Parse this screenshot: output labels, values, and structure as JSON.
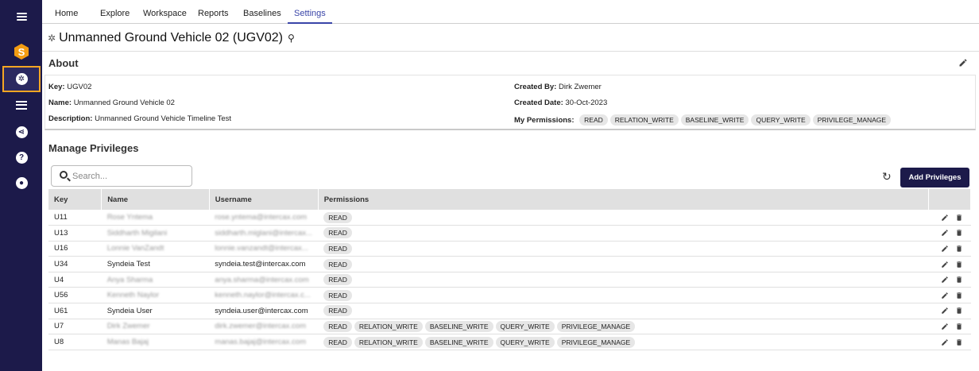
{
  "nav": {
    "tabs": [
      {
        "label": "Home"
      },
      {
        "label": "Explore"
      },
      {
        "label": "Workspace"
      },
      {
        "label": "Reports"
      },
      {
        "label": "Baselines"
      },
      {
        "label": "Settings"
      }
    ],
    "active_tab": "Settings"
  },
  "rail": {
    "icons": [
      "menu-icon",
      "syndeia-logo-icon",
      "project-icon",
      "list-icon",
      "share-icon",
      "help-icon",
      "account-icon"
    ]
  },
  "page": {
    "title": "Unmanned Ground Vehicle 02 (UGV02)"
  },
  "about": {
    "heading": "About",
    "key_label": "Key:",
    "key_value": "UGV02",
    "name_label": "Name:",
    "name_value": "Unmanned Ground Vehicle 02",
    "desc_label": "Description:",
    "desc_value": "Unmanned Ground Vehicle Timeline Test",
    "created_by_label": "Created By:",
    "created_by_value": "Dirk Zwemer",
    "created_date_label": "Created Date:",
    "created_date_value": "30-Oct-2023",
    "perms_label": "My Permissions:",
    "perms": [
      "READ",
      "RELATION_WRITE",
      "BASELINE_WRITE",
      "QUERY_WRITE",
      "PRIVILEGE_MANAGE"
    ]
  },
  "privileges": {
    "heading": "Manage Privileges",
    "search_placeholder": "Search...",
    "add_label": "Add Privileges",
    "columns": [
      "Key",
      "Name",
      "Username",
      "Permissions"
    ],
    "rows": [
      {
        "key": "U11",
        "name": "Rose Yntema",
        "username": "rose.yntema@intercax.com",
        "perms": [
          "READ"
        ],
        "blurred": true
      },
      {
        "key": "U13",
        "name": "Siddharth Migilani",
        "username": "siddharth.miglani@intercax...",
        "perms": [
          "READ"
        ],
        "blurred": true
      },
      {
        "key": "U16",
        "name": "Lonnie VanZandt",
        "username": "lonnie.vanzandt@intercax...",
        "perms": [
          "READ"
        ],
        "blurred": true
      },
      {
        "key": "U34",
        "name": "Syndeia Test",
        "username": "syndeia.test@intercax.com",
        "perms": [
          "READ"
        ],
        "blurred": false
      },
      {
        "key": "U4",
        "name": "Anya Sharma",
        "username": "anya.sharma@intercax.com",
        "perms": [
          "READ"
        ],
        "blurred": true
      },
      {
        "key": "U56",
        "name": "Kenneth Naylor",
        "username": "kenneth.naylor@intercax.c...",
        "perms": [
          "READ"
        ],
        "blurred": true
      },
      {
        "key": "U61",
        "name": "Syndeia User",
        "username": "syndeia.user@intercax.com",
        "perms": [
          "READ"
        ],
        "blurred": false
      },
      {
        "key": "U7",
        "name": "Dirk Zwemer",
        "username": "dirk.zwemer@intercax.com",
        "perms": [
          "READ",
          "RELATION_WRITE",
          "BASELINE_WRITE",
          "QUERY_WRITE",
          "PRIVILEGE_MANAGE"
        ],
        "blurred": true
      },
      {
        "key": "U8",
        "name": "Manas Bajaj",
        "username": "manas.bajaj@intercax.com",
        "perms": [
          "READ",
          "RELATION_WRITE",
          "BASELINE_WRITE",
          "QUERY_WRITE",
          "PRIVILEGE_MANAGE"
        ],
        "blurred": true
      }
    ]
  },
  "colors": {
    "rail": "#1c1a4a",
    "accent": "#3a45a8",
    "highlight": "#f5a623",
    "button": "#1c1a4a"
  }
}
